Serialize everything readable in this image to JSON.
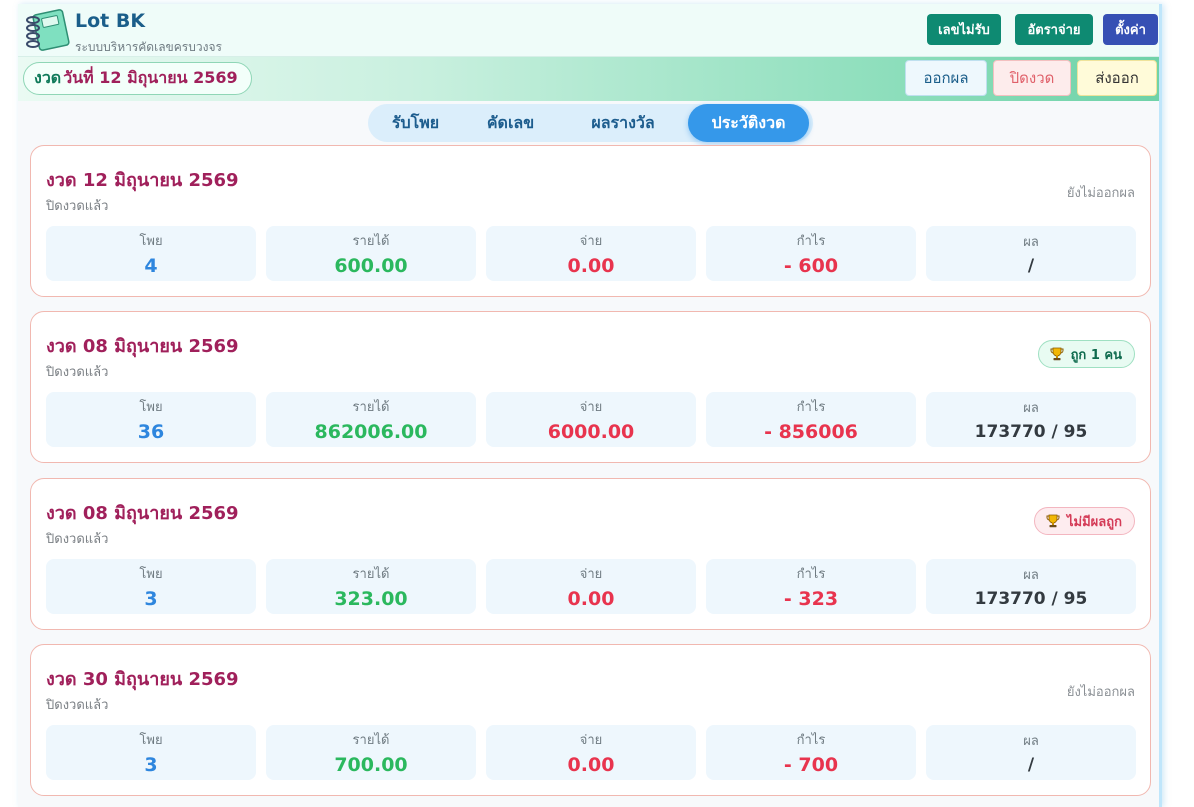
{
  "app": {
    "title": "Lot BK",
    "subtitle": "ระบบบริหารคัดเลขครบวงจร"
  },
  "header_buttons": [
    {
      "label": "เลขไม่รับ",
      "color": "#0e8a72"
    },
    {
      "label": "อัตราจ่าย",
      "color": "#0e8a72"
    },
    {
      "label": "ตั้งค่า",
      "color": "#3650b4"
    }
  ],
  "current_draw": {
    "prefix": "งวด",
    "date": "วันที่ 12 มิถุนายน 2569"
  },
  "action_buttons": [
    {
      "label": "ออกผล",
      "bg": "#eef8fd",
      "border": "#bfe0ef",
      "color": "#1b5e8a"
    },
    {
      "label": "ปิดงวด",
      "bg": "#fdecec",
      "border": "#f3c0c0",
      "color": "#e0606a"
    },
    {
      "label": "ส่งออก",
      "bg": "#fffbd9",
      "border": "#efe39b",
      "color": "#333333"
    }
  ],
  "tabs": [
    {
      "label": "รับโพย",
      "active": false
    },
    {
      "label": "คัดเลข",
      "active": false
    },
    {
      "label": "ผลรางวัล",
      "active": false
    },
    {
      "label": "ประวัติงวด",
      "active": true
    }
  ],
  "stat_labels": {
    "tickets": "โพย",
    "income": "รายได้",
    "payout": "จ่าย",
    "profit": "กำไร",
    "result": "ผล"
  },
  "rounds": [
    {
      "title": "งวด 12 มิถุนายน 2569",
      "status": "ปิดงวดแล้ว",
      "result_type": "none",
      "result_text": "ยังไม่ออกผล",
      "tickets": "4",
      "income": "600.00",
      "payout": "0.00",
      "profit": "- 600",
      "result": "/"
    },
    {
      "title": "งวด 08 มิถุนายน 2569",
      "status": "ปิดงวดแล้ว",
      "result_type": "win",
      "result_text": "ถูก 1 คน",
      "tickets": "36",
      "income": "862006.00",
      "payout": "6000.00",
      "profit": "- 856006",
      "result": "173770 / 95"
    },
    {
      "title": "งวด 08 มิถุนายน 2569",
      "status": "ปิดงวดแล้ว",
      "result_type": "lose",
      "result_text": "ไม่มีผลถูก",
      "tickets": "3",
      "income": "323.00",
      "payout": "0.00",
      "profit": "- 323",
      "result": "173770 / 95"
    },
    {
      "title": "งวด 30 มิถุนายน 2569",
      "status": "ปิดงวดแล้ว",
      "result_type": "none",
      "result_text": "ยังไม่ออกผล",
      "tickets": "3",
      "income": "700.00",
      "payout": "0.00",
      "profit": "- 700",
      "result": "/"
    }
  ],
  "icons": {
    "logo": "notebook-icon",
    "trophy": "trophy-icon"
  }
}
